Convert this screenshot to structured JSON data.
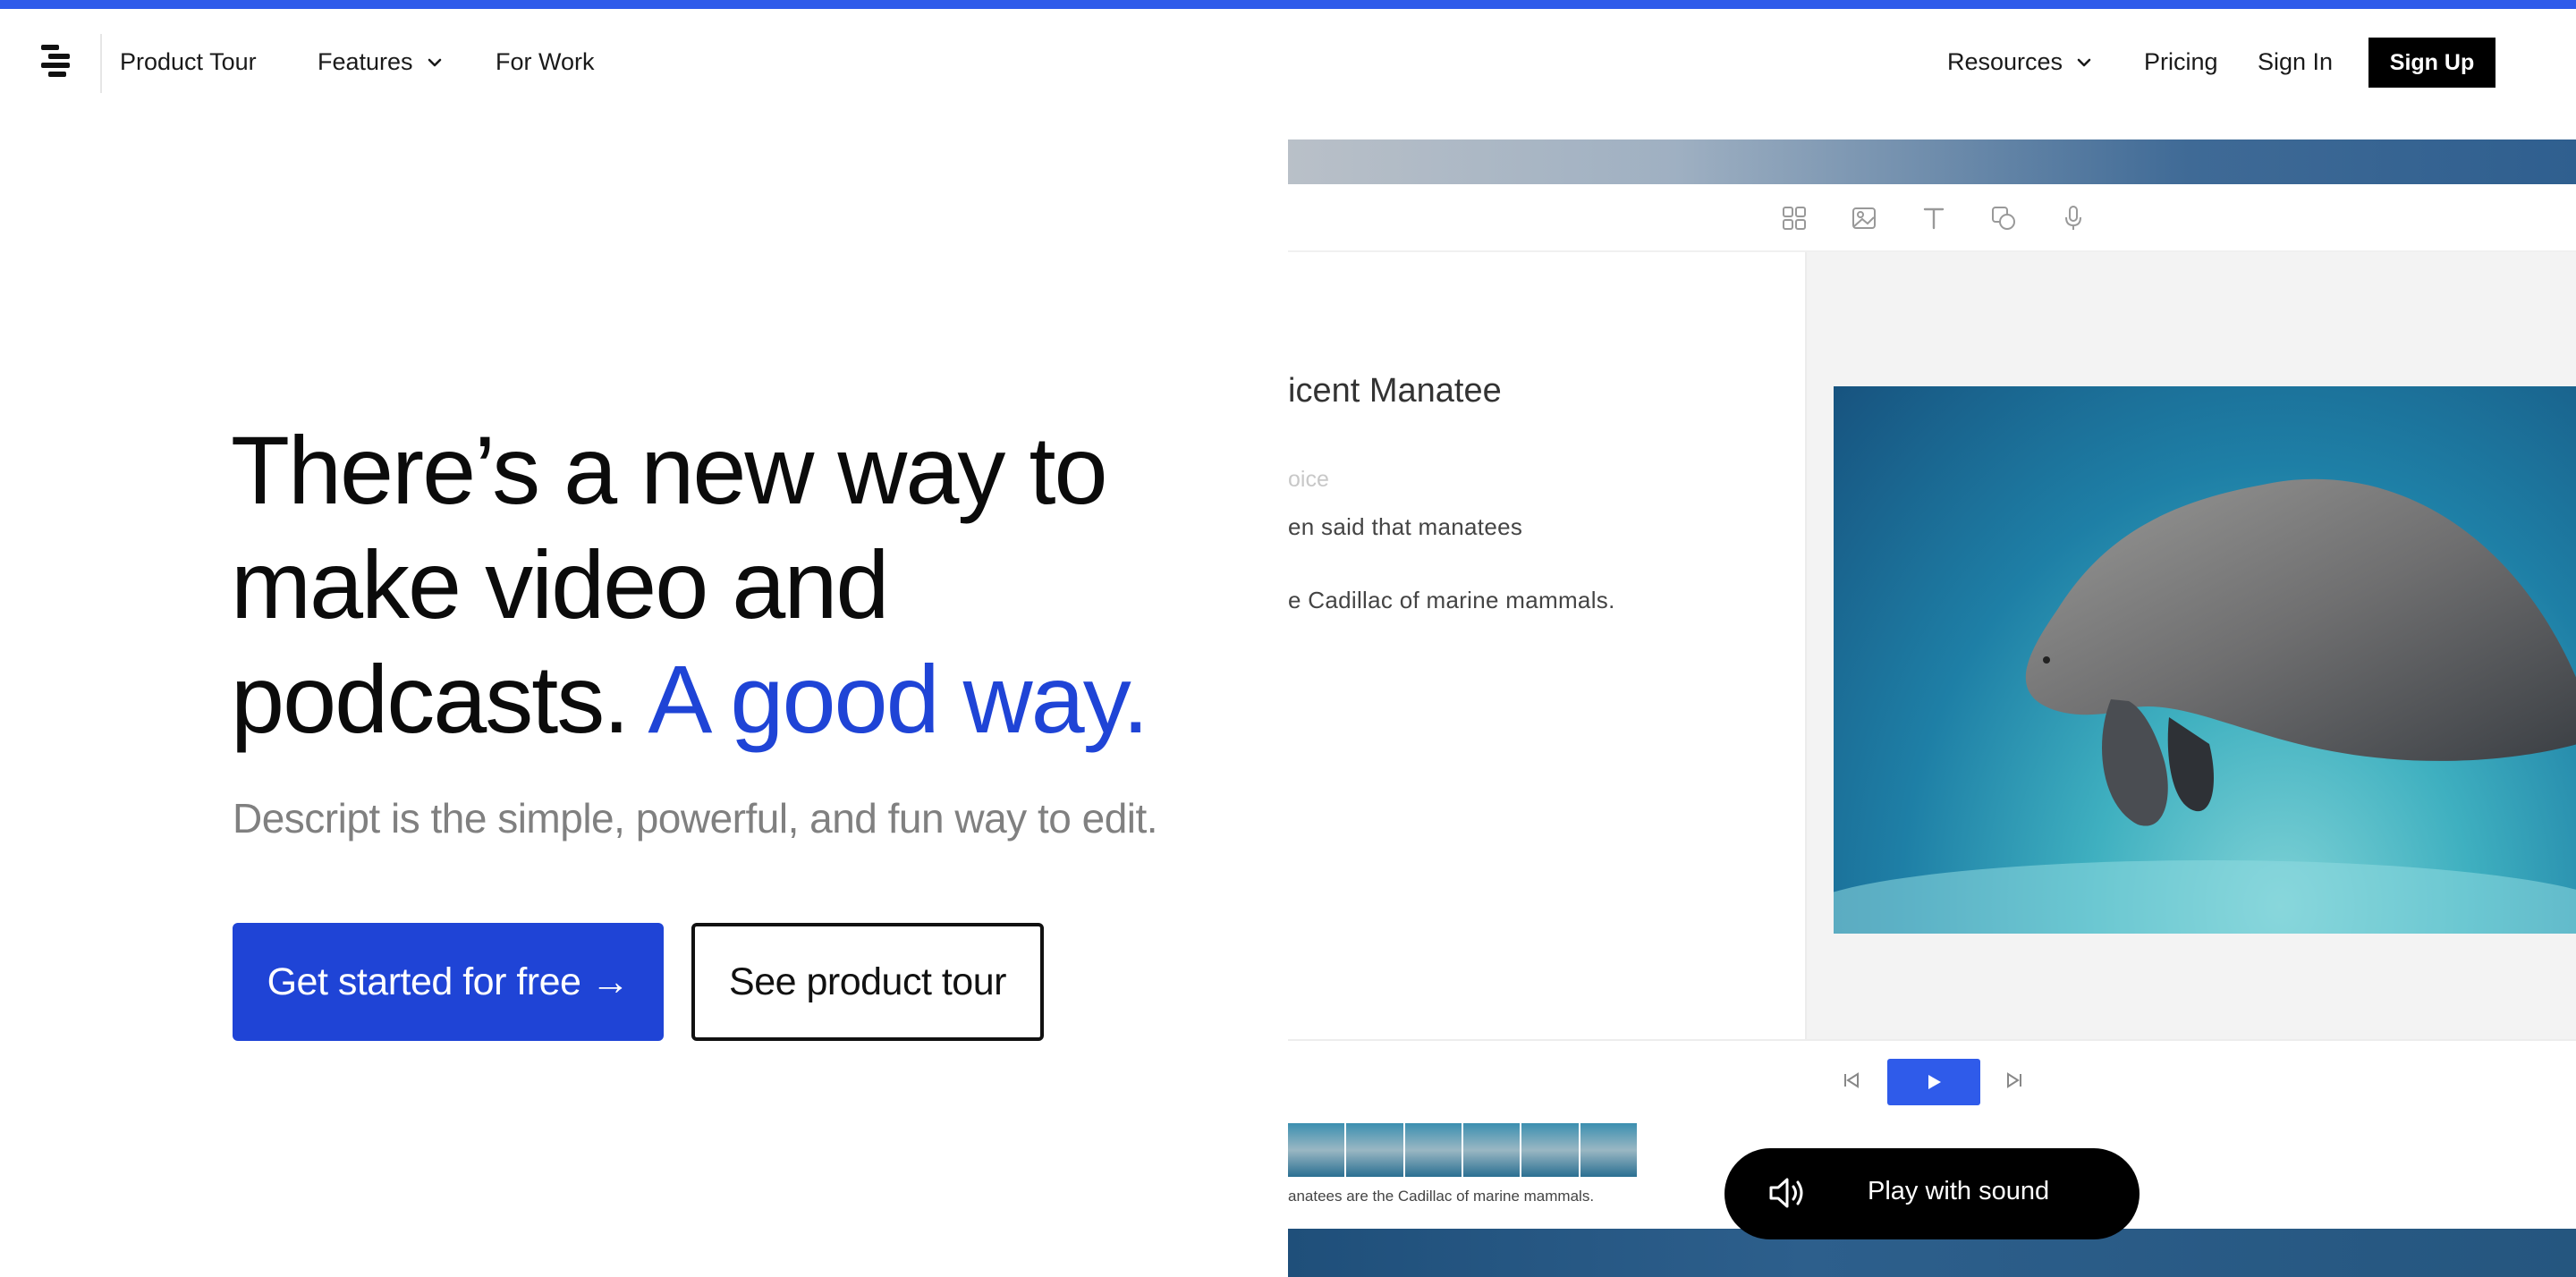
{
  "nav": {
    "left_items": [
      {
        "label": "Product Tour"
      },
      {
        "label": "Features"
      },
      {
        "label": "For Work"
      }
    ],
    "right_items": [
      {
        "label": "Resources"
      },
      {
        "label": "Pricing"
      },
      {
        "label": "Sign In"
      }
    ],
    "signup_label": "Sign Up"
  },
  "hero": {
    "headline_line1": "There’s a new way to",
    "headline_line2": "make video and",
    "headline_line3": "podcasts.",
    "headline_accent": "A good way.",
    "subhead": "Descript is the simple, powerful, and fun way to edit.",
    "primary_cta": "Get started for free →",
    "secondary_cta": "See product tour"
  },
  "mock": {
    "doc_title": "icent Manatee",
    "speaker": "oice",
    "lines": [
      "en said that manatees",
      "e Cadillac of marine mammals."
    ],
    "timeline_caption": "anatees are the Cadillac of marine mammals."
  },
  "sound_button": {
    "label": "Play with sound",
    "icon": "speaker-icon"
  },
  "colors": {
    "accent_blue": "#1f44d6",
    "top_bar": "#2f5bea",
    "black": "#000000"
  }
}
